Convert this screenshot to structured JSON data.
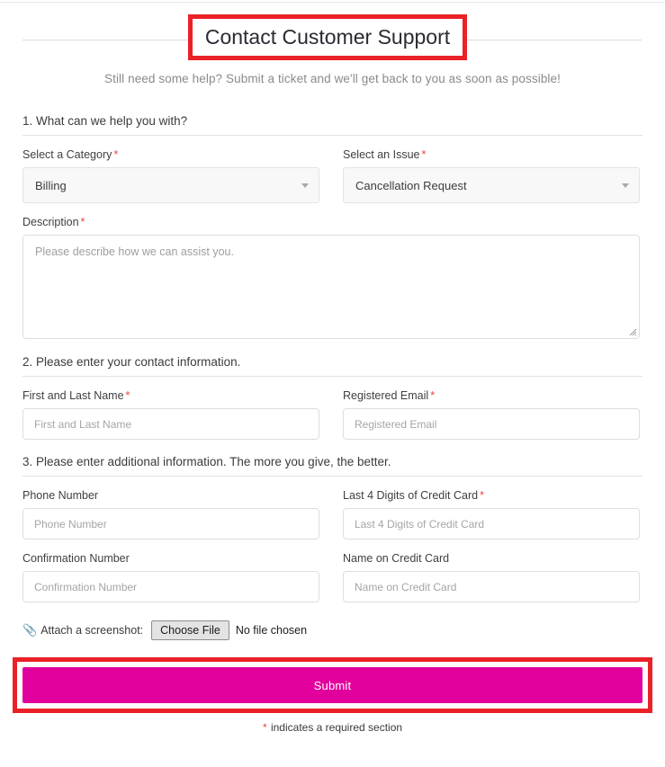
{
  "page": {
    "title": "Contact Customer Support",
    "subtitle": "Still need some help? Submit a ticket and we'll get back to you as soon as possible!",
    "footnote_star": "*",
    "footnote_text": " indicates a required section",
    "required_marker": "*"
  },
  "colors": {
    "accent_submit": "#e2009c",
    "annotation_box": "#ea2127",
    "required_star": "#ee3f44",
    "input_border": "#dedede",
    "select_background": "#f8f8f8"
  },
  "sections": [
    {
      "heading": "1. What can we help you with?"
    },
    {
      "heading": "2. Please enter your contact information."
    },
    {
      "heading": "3. Please enter additional information. The more you give, the better."
    }
  ],
  "fields": {
    "category": {
      "label": "Select a Category",
      "required_marker": "*",
      "value": "Billing"
    },
    "issue": {
      "label": "Select an Issue",
      "required_marker": "*",
      "value": "Cancellation Request"
    },
    "description": {
      "label": "Description",
      "required_marker": "*",
      "value": "",
      "placeholder": "Please describe how we can assist you."
    },
    "name": {
      "label": "First and Last Name",
      "required_marker": "*",
      "value": "",
      "placeholder": "First and Last Name"
    },
    "email": {
      "label": "Registered Email",
      "required_marker": "*",
      "value": "",
      "placeholder": "Registered Email"
    },
    "phone": {
      "label": "Phone Number",
      "required_marker": "",
      "value": "",
      "placeholder": "Phone Number"
    },
    "last4": {
      "label": "Last 4 Digits of Credit Card",
      "required_marker": "*",
      "value": "",
      "placeholder": "Last 4 Digits of Credit Card"
    },
    "confirmation": {
      "label": "Confirmation Number",
      "required_marker": "",
      "value": "",
      "placeholder": "Confirmation Number"
    },
    "card_name": {
      "label": "Name on Credit Card",
      "required_marker": "",
      "value": "",
      "placeholder": "Name on Credit Card"
    }
  },
  "attachment": {
    "icon": "paperclip-icon",
    "label": "Attach a screenshot:",
    "button_label": "Choose File",
    "status": "No file chosen"
  },
  "submit": {
    "label": "Submit"
  }
}
